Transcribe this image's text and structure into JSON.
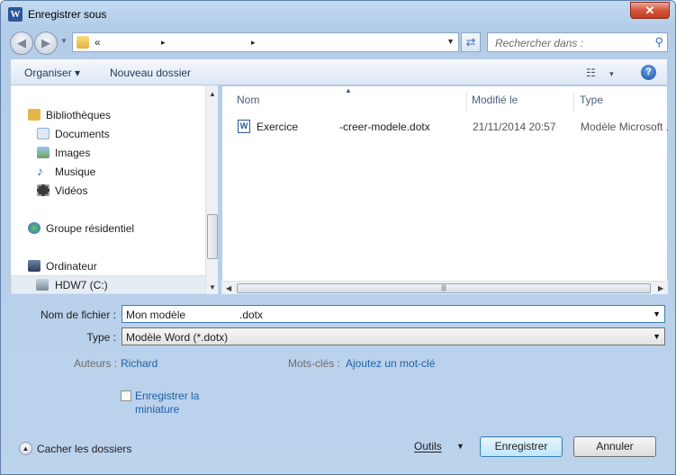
{
  "window": {
    "title": "Enregistrer sous",
    "app_icon": "W",
    "close": "✕"
  },
  "address": {
    "segments": [
      "«",
      "▸",
      "▸"
    ]
  },
  "search": {
    "placeholder": "Rechercher dans :"
  },
  "toolbar": {
    "organize": "Organiser ▾",
    "new_folder": "Nouveau dossier",
    "view": "▾",
    "help": "?"
  },
  "nav": {
    "items": [
      {
        "label": "Bibliothèques",
        "icon": "library-icon",
        "color": "#e2b84a"
      },
      {
        "label": "Documents",
        "icon": "documents-icon",
        "color": "#8fb2d9"
      },
      {
        "label": "Images",
        "icon": "images-icon",
        "color": "#6aa35b"
      },
      {
        "label": "Musique",
        "icon": "music-icon",
        "color": "#2f6fc2"
      },
      {
        "label": "Vidéos",
        "icon": "videos-icon",
        "color": "#3a3a3a"
      },
      {
        "label": "Groupe résidentiel",
        "icon": "homegroup-icon",
        "color": "#3a8e3a"
      },
      {
        "label": "Ordinateur",
        "icon": "computer-icon",
        "color": "#4a5f7b"
      },
      {
        "label": "HDW7 (C:)",
        "icon": "drive-icon",
        "color": "#7b8a9a"
      }
    ]
  },
  "columns": {
    "name": "Nom",
    "modified": "Modifié le",
    "type": "Type"
  },
  "files": [
    {
      "name_start": "Exercice",
      "name_end": "-creer-modele.dotx",
      "modified": "21/11/2014 20:57",
      "type": "Modèle Microsoft ..."
    }
  ],
  "form": {
    "filename_label": "Nom de fichier :",
    "filename_value": "Mon modèle",
    "filename_ext": ".dotx",
    "type_label": "Type :",
    "type_value": "Modèle Word (*.dotx)",
    "authors_label": "Auteurs :",
    "authors_value": "Richard",
    "keywords_label": "Mots-clés :",
    "keywords_value": "Ajoutez un mot-clé",
    "thumbnail_label": "Enregistrer la miniature"
  },
  "footer": {
    "hide_folders": "Cacher les dossiers",
    "tools": "Outils",
    "save": "Enregistrer",
    "cancel": "Annuler"
  }
}
